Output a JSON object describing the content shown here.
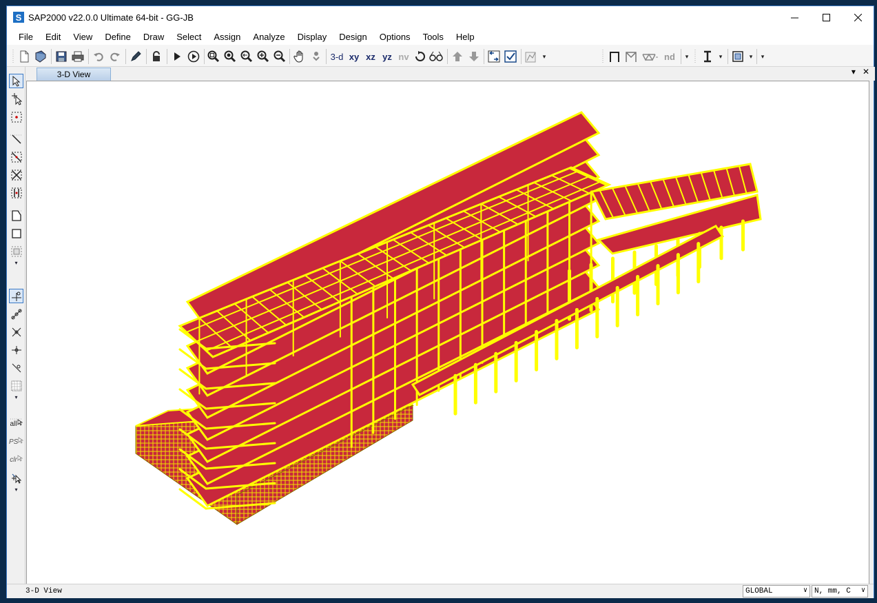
{
  "window": {
    "app_icon": "S",
    "title": "SAP2000 v22.0.0 Ultimate 64-bit - GG-JB",
    "controls": [
      "minimize-icon",
      "maximize-icon",
      "close-icon"
    ]
  },
  "menu": [
    "File",
    "Edit",
    "View",
    "Define",
    "Draw",
    "Select",
    "Assign",
    "Analyze",
    "Display",
    "Design",
    "Options",
    "Tools",
    "Help"
  ],
  "toolbar": {
    "view_labels": [
      "3-d",
      "xy",
      "xz",
      "yz",
      "nv"
    ],
    "nd_label": "nd"
  },
  "left_tools": {
    "all_label": "all",
    "ps_label": "PS",
    "clr_label": "clr"
  },
  "tab": {
    "label": "3-D View"
  },
  "status": {
    "view_name": "3-D View",
    "coord_system": "GLOBAL",
    "units": "N, mm, C"
  },
  "model": {
    "shell_color": "#c8283c",
    "frame_color": "#ffff00",
    "edge_color": "#8a6a00"
  }
}
